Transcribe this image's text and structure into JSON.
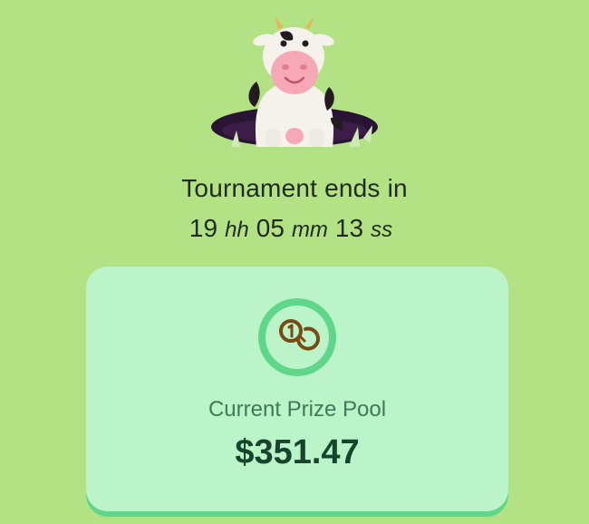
{
  "header": {
    "title": "Tournament ends in"
  },
  "countdown": {
    "hours": "19",
    "hours_unit": "hh",
    "minutes": "05",
    "minutes_unit": "mm",
    "seconds": "13",
    "seconds_unit": "ss"
  },
  "prize": {
    "label": "Current Prize Pool",
    "amount": "$351.47",
    "icon": "coins-icon"
  },
  "mascot": {
    "icon": "cow-in-hole-icon"
  },
  "colors": {
    "background": "#b3e285",
    "card": "#bbf4c8",
    "accent": "#5fd68a",
    "amount": "#16452c"
  }
}
